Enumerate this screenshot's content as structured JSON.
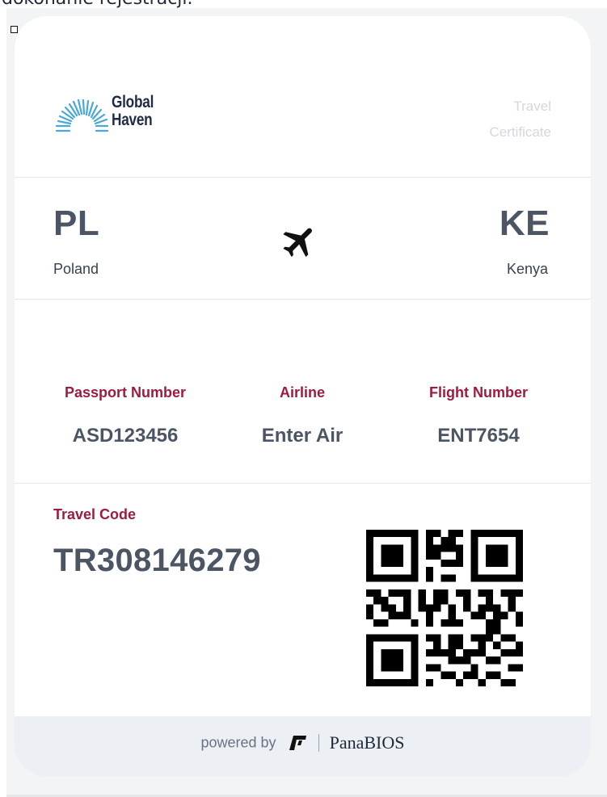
{
  "page": {
    "top_text": "dokonanie rejestracji."
  },
  "logo": {
    "line1": "Global",
    "line2": "Haven"
  },
  "certificate": {
    "title_line1": "Travel",
    "title_line2": "Certificate"
  },
  "route": {
    "from_code": "PL",
    "from_country": "Poland",
    "to_code": "KE",
    "to_country": "Kenya"
  },
  "details": {
    "passport_label": "Passport Number",
    "passport_value": "ASD123456",
    "airline_label": "Airline",
    "airline_value": "Enter Air",
    "flight_label": "Flight Number",
    "flight_value": "ENT7654"
  },
  "travel_code": {
    "label": "Travel Code",
    "value": "TR308146279"
  },
  "footer": {
    "powered_by": "powered by",
    "brand": "PanaBIOS"
  },
  "icons": {
    "plane": "airplane-icon",
    "qr": "qr-code-icon",
    "checkbox": "checkbox-icon"
  },
  "colors": {
    "accent_label": "#9b1c3f",
    "value_text": "#4b5563",
    "logo_blue": "#4aa8d8",
    "logo_text": "#1f2a44",
    "footer_bg": "#eceff4"
  }
}
